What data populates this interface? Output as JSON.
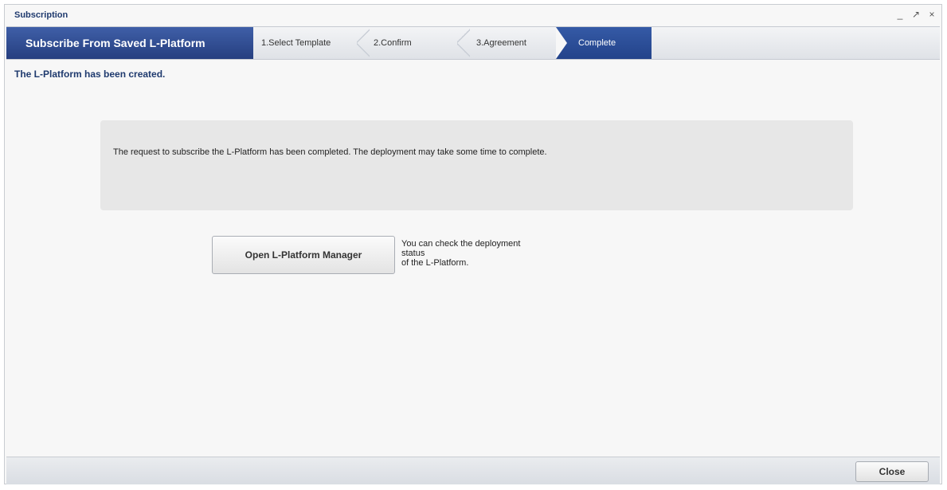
{
  "window": {
    "title": "Subscription",
    "controls": {
      "minimize": "_",
      "restore": "↗",
      "close": "×"
    }
  },
  "wizard": {
    "title": "Subscribe From Saved L-Platform",
    "steps": [
      {
        "label": "1.Select Template"
      },
      {
        "label": "2.Confirm"
      },
      {
        "label": "3.Agreement"
      },
      {
        "label": "Complete"
      }
    ]
  },
  "status_message": "The L-Platform has been created.",
  "message_box": {
    "text": "The request to subscribe the L-Platform has been completed. The deployment may take some time to complete."
  },
  "actions": {
    "open_button_label": "Open L-Platform Manager",
    "hint_lines": [
      "You can check the deployment status",
      "of the L-Platform."
    ]
  },
  "footer": {
    "close_button_label": "Close"
  }
}
